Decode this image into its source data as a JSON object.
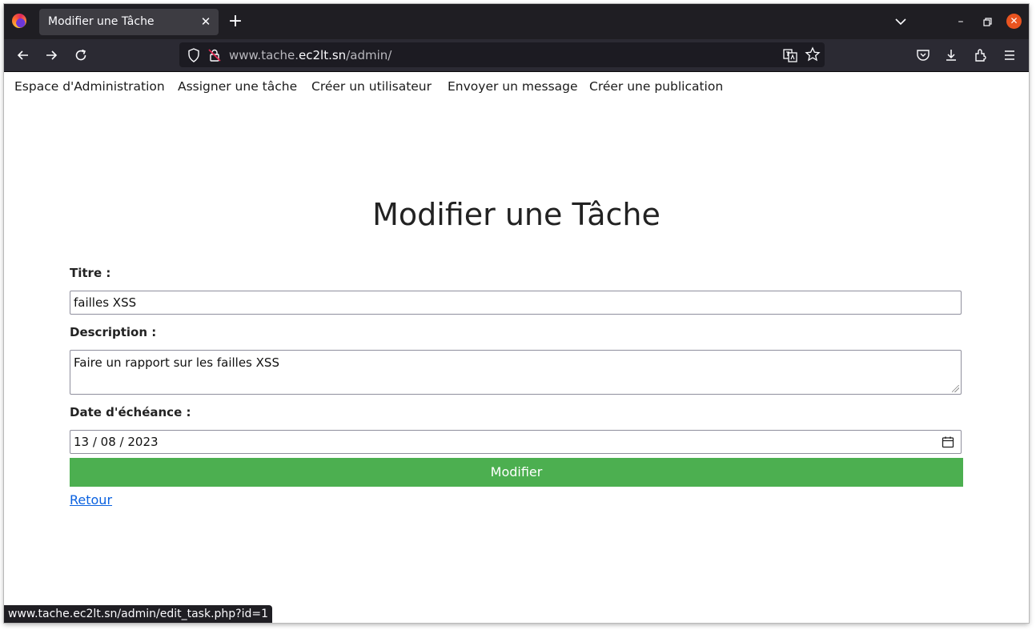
{
  "browser": {
    "tab_title": "Modifier une Tâche",
    "tab_close": "✕",
    "new_tab": "+",
    "url_prefix": "www.tache.",
    "url_domain": "ec2lt.sn",
    "url_path": "/admin/",
    "status_url": "www.tache.ec2lt.sn/admin/edit_task.php?id=1",
    "window_minimize": "–",
    "window_close": "✕"
  },
  "nav": {
    "items": [
      {
        "label": "Espace d'Administration"
      },
      {
        "label": "Assigner une tâche"
      },
      {
        "label": "Créer un utilisateur"
      },
      {
        "label": "Envoyer un message"
      },
      {
        "label": "Créer une publication"
      }
    ]
  },
  "form": {
    "heading": "Modifier une Tâche",
    "title_label": "Titre :",
    "title_value": "failles XSS",
    "description_label": "Description :",
    "description_value": "Faire un rapport sur les failles XSS",
    "due_date_label": "Date d'échéance :",
    "due_date_value": "13 / 08 / 2023",
    "submit_label": "Modifier",
    "back_label": "Retour"
  },
  "colors": {
    "submit_bg": "#4caf50",
    "link": "#0b62e0",
    "toolbar": "#2b2a33",
    "tabbar": "#1f1e23"
  }
}
